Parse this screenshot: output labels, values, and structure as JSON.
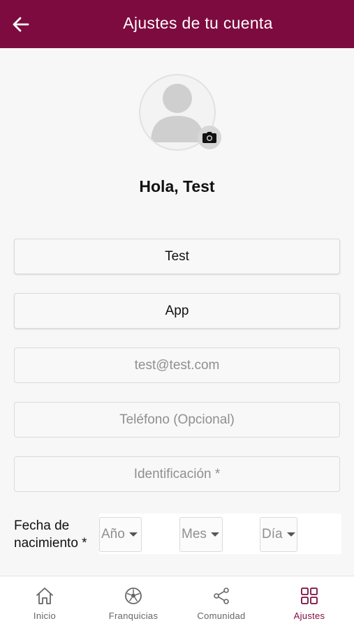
{
  "appbar": {
    "title": "Ajustes de tu cuenta"
  },
  "profile": {
    "greeting": "Hola, Test"
  },
  "form": {
    "first_name": {
      "value": "Test"
    },
    "last_name": {
      "value": "App"
    },
    "email": {
      "placeholder": "test@test.com"
    },
    "phone": {
      "placeholder": "Teléfono (Opcional)"
    },
    "identification": {
      "placeholder": "Identificación *"
    },
    "birthdate": {
      "label": "Fecha de nacimiento *",
      "year": "Año",
      "month": "Mes",
      "day": "Día"
    }
  },
  "nav": {
    "items": [
      {
        "label": "Inicio",
        "icon": "home-icon"
      },
      {
        "label": "Franquicias",
        "icon": "soccer-ball-icon"
      },
      {
        "label": "Comunidad",
        "icon": "share-icon"
      },
      {
        "label": "Ajustes",
        "icon": "grid-icon",
        "active": true
      }
    ]
  },
  "colors": {
    "primary": "#7d0b3f",
    "inactive": "#666666"
  }
}
